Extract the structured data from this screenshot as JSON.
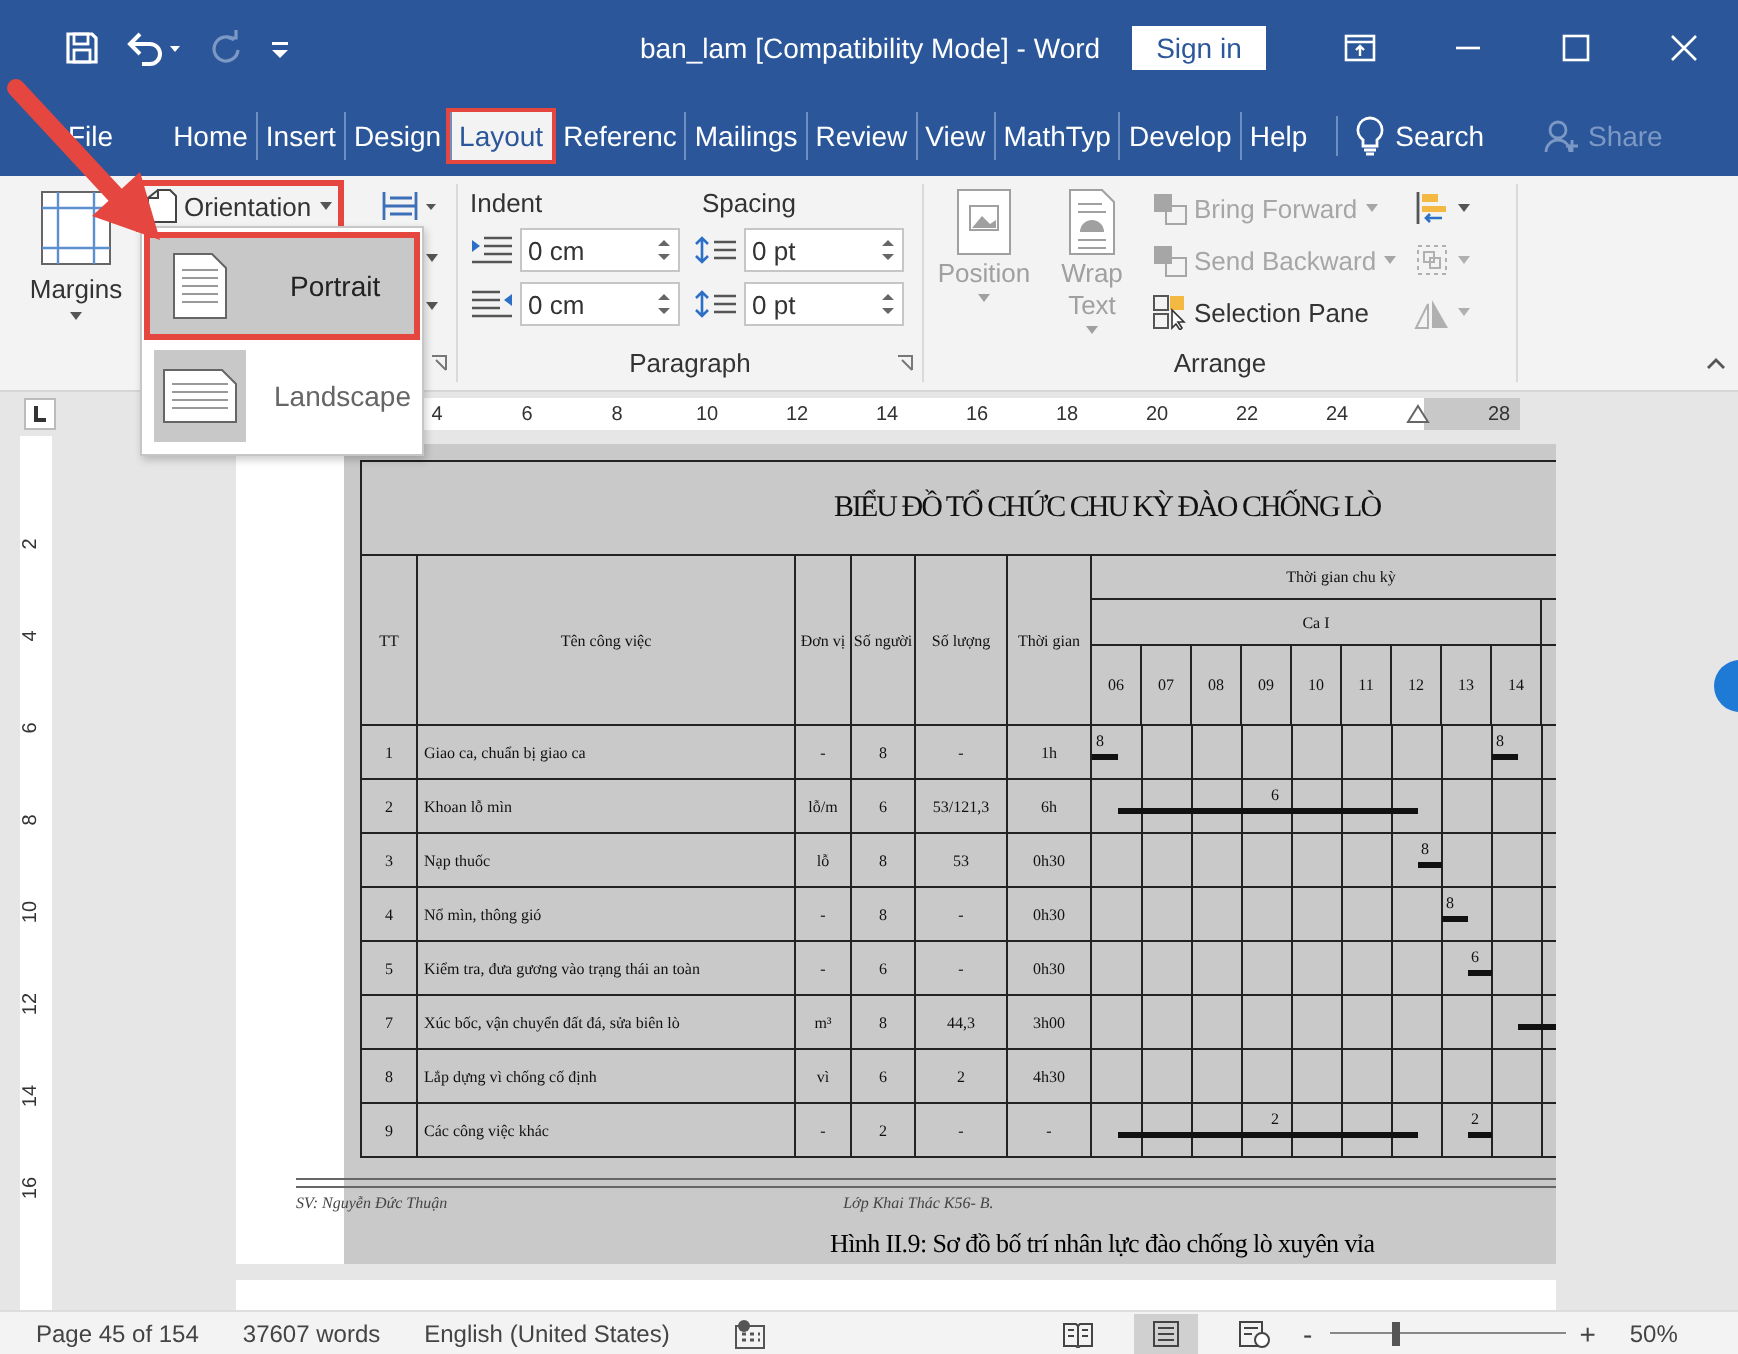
{
  "title_bar": {
    "title": "ban_lam [Compatibility Mode]  -  Word",
    "sign_in": "Sign in",
    "quick_access": [
      {
        "kind": "save",
        "disabled": false
      },
      {
        "kind": "undo",
        "disabled": false
      },
      {
        "kind": "redo",
        "disabled": true
      },
      {
        "kind": "customize",
        "disabled": false
      }
    ]
  },
  "tabs": [
    {
      "label": "File",
      "selected": false,
      "highlighted": false
    },
    {
      "label": "Home",
      "selected": false,
      "highlighted": false
    },
    {
      "label": "Insert",
      "selected": false,
      "highlighted": false
    },
    {
      "label": "Design",
      "selected": false,
      "highlighted": false
    },
    {
      "label": "Layout",
      "selected": true,
      "highlighted": true
    },
    {
      "label": "Referenc",
      "selected": false,
      "highlighted": false
    },
    {
      "label": "Mailings",
      "selected": false,
      "highlighted": false
    },
    {
      "label": "Review",
      "selected": false,
      "highlighted": false
    },
    {
      "label": "View",
      "selected": false,
      "highlighted": false
    },
    {
      "label": "MathTyp",
      "selected": false,
      "highlighted": false
    },
    {
      "label": "Develop",
      "selected": false,
      "highlighted": false
    },
    {
      "label": "Help",
      "selected": false,
      "highlighted": false
    }
  ],
  "search": {
    "label": "Search"
  },
  "share": {
    "label": "Share",
    "disabled": true
  },
  "ribbon": {
    "margins": {
      "label": "Margins"
    },
    "orientation": {
      "label": "Orientation",
      "highlighted": true
    },
    "orientation_menu": [
      {
        "label": "Portrait",
        "kind": "portrait",
        "selected": true,
        "highlighted": true
      },
      {
        "label": "Landscape",
        "kind": "landscape",
        "selected": false,
        "highlighted": false
      }
    ],
    "paragraph": {
      "title": "Paragraph",
      "indent_label": "Indent",
      "spacing_label": "Spacing",
      "indent_left": "0 cm",
      "indent_right": "0 cm",
      "spacing_before": "0 pt",
      "spacing_after": "0 pt"
    },
    "arrange": {
      "title": "Arrange",
      "large_buttons": [
        {
          "label": "Position",
          "kind": "position",
          "disabled": true
        },
        {
          "label": "Wrap Text",
          "kind": "wrap",
          "disabled": true
        }
      ],
      "small_buttons": [
        {
          "label": "Bring Forward",
          "kind": "bring-forward",
          "disabled": true
        },
        {
          "label": "Send Backward",
          "kind": "send-backward",
          "disabled": true
        },
        {
          "label": "Selection Pane",
          "kind": "selection-pane",
          "disabled": false
        }
      ],
      "icon_buttons": [
        {
          "kind": "align",
          "disabled": false
        },
        {
          "kind": "group",
          "disabled": true
        },
        {
          "kind": "rotate",
          "disabled": true
        }
      ]
    }
  },
  "ruler": {
    "horizontal": [
      "4",
      "6",
      "8",
      "10",
      "12",
      "14",
      "16",
      "18",
      "20",
      "22",
      "24"
    ],
    "horizontal_end": "28",
    "vertical": [
      "2",
      "4",
      "6",
      "8",
      "10",
      "12",
      "14",
      "16"
    ]
  },
  "document": {
    "title": "BIỂU ĐỒ TỔ CHỨC CHU KỲ ĐÀO CHỐNG LÒ",
    "columns": [
      "TT",
      "Tên công việc",
      "Đơn vị",
      "Số người",
      "Số lượng",
      "Thời gian"
    ],
    "schedule_header": "Thời gian chu kỳ",
    "shift": "Ca I",
    "hours": [
      "06",
      "07",
      "08",
      "09",
      "10",
      "11",
      "12",
      "13",
      "14"
    ],
    "rows": [
      {
        "cells": [
          "1",
          "Giao ca, chuẩn bị giao ca",
          "-",
          "8",
          "-",
          "1h"
        ],
        "slots": [
          {
            "filled": true,
            "label": "8"
          },
          {
            "filled": false
          },
          {
            "filled": false
          },
          {
            "filled": false
          },
          {
            "filled": false
          },
          {
            "filled": false
          },
          {
            "filled": false
          },
          {
            "filled": false
          },
          {
            "filled": false
          },
          {
            "filled": false
          },
          {
            "filled": false
          },
          {
            "filled": false
          },
          {
            "filled": false
          },
          {
            "filled": false
          },
          {
            "filled": false
          },
          {
            "filled": false
          },
          {
            "filled": true,
            "label": "8"
          },
          {
            "filled": false
          },
          {
            "filled": false
          }
        ]
      },
      {
        "cells": [
          "2",
          "Khoan lỗ mìn",
          "lỗ/m",
          "6",
          "53/121,3",
          "6h"
        ],
        "slots": [
          {
            "filled": false
          },
          {
            "filled": true
          },
          {
            "filled": true
          },
          {
            "filled": true
          },
          {
            "filled": true
          },
          {
            "filled": true
          },
          {
            "filled": true
          },
          {
            "filled": true,
            "label": "6"
          },
          {
            "filled": true
          },
          {
            "filled": true
          },
          {
            "filled": true
          },
          {
            "filled": true
          },
          {
            "filled": true
          },
          {
            "filled": false
          },
          {
            "filled": false
          },
          {
            "filled": false
          },
          {
            "filled": false
          },
          {
            "filled": false
          },
          {
            "filled": false
          }
        ]
      },
      {
        "cells": [
          "3",
          "Nạp thuốc",
          "lỗ",
          "8",
          "53",
          "0h30"
        ],
        "slots": [
          {
            "filled": false
          },
          {
            "filled": false
          },
          {
            "filled": false
          },
          {
            "filled": false
          },
          {
            "filled": false
          },
          {
            "filled": false
          },
          {
            "filled": false
          },
          {
            "filled": false
          },
          {
            "filled": false
          },
          {
            "filled": false
          },
          {
            "filled": false
          },
          {
            "filled": false
          },
          {
            "filled": false
          },
          {
            "filled": true,
            "label": "8"
          },
          {
            "filled": false
          },
          {
            "filled": false
          },
          {
            "filled": false
          },
          {
            "filled": false
          },
          {
            "filled": false
          }
        ]
      },
      {
        "cells": [
          "4",
          "Nổ mìn, thông gió",
          "-",
          "8",
          "-",
          "0h30"
        ],
        "slots": [
          {
            "filled": false
          },
          {
            "filled": false
          },
          {
            "filled": false
          },
          {
            "filled": false
          },
          {
            "filled": false
          },
          {
            "filled": false
          },
          {
            "filled": false
          },
          {
            "filled": false
          },
          {
            "filled": false
          },
          {
            "filled": false
          },
          {
            "filled": false
          },
          {
            "filled": false
          },
          {
            "filled": false
          },
          {
            "filled": false
          },
          {
            "filled": true,
            "label": "8"
          },
          {
            "filled": false
          },
          {
            "filled": false
          },
          {
            "filled": false
          },
          {
            "filled": false
          }
        ]
      },
      {
        "cells": [
          "5",
          "Kiểm tra, đưa gương vào trạng thái an toàn",
          "-",
          "6",
          "-",
          "0h30"
        ],
        "slots": [
          {
            "filled": false
          },
          {
            "filled": false
          },
          {
            "filled": false
          },
          {
            "filled": false
          },
          {
            "filled": false
          },
          {
            "filled": false
          },
          {
            "filled": false
          },
          {
            "filled": false
          },
          {
            "filled": false
          },
          {
            "filled": false
          },
          {
            "filled": false
          },
          {
            "filled": false
          },
          {
            "filled": false
          },
          {
            "filled": false
          },
          {
            "filled": false
          },
          {
            "filled": true,
            "label": "6"
          },
          {
            "filled": false
          },
          {
            "filled": false
          },
          {
            "filled": false
          }
        ]
      },
      {
        "cells": [
          "7",
          "Xúc bốc, vận chuyển đất đá, sửa biên lò",
          "m³",
          "8",
          "44,3",
          "3h00"
        ],
        "slots": [
          {
            "filled": false
          },
          {
            "filled": false
          },
          {
            "filled": false
          },
          {
            "filled": false
          },
          {
            "filled": false
          },
          {
            "filled": false
          },
          {
            "filled": false
          },
          {
            "filled": false
          },
          {
            "filled": false
          },
          {
            "filled": false
          },
          {
            "filled": false
          },
          {
            "filled": false
          },
          {
            "filled": false
          },
          {
            "filled": false
          },
          {
            "filled": false
          },
          {
            "filled": false
          },
          {
            "filled": false
          },
          {
            "filled": true
          },
          {
            "filled": true
          }
        ]
      },
      {
        "cells": [
          "8",
          "Lắp dựng vì chống cố định",
          "vì",
          "6",
          "2",
          "4h30"
        ],
        "slots": [
          {
            "filled": false
          },
          {
            "filled": false
          },
          {
            "filled": false
          },
          {
            "filled": false
          },
          {
            "filled": false
          },
          {
            "filled": false
          },
          {
            "filled": false
          },
          {
            "filled": false
          },
          {
            "filled": false
          },
          {
            "filled": false
          },
          {
            "filled": false
          },
          {
            "filled": false
          },
          {
            "filled": false
          },
          {
            "filled": false
          },
          {
            "filled": false
          },
          {
            "filled": false
          },
          {
            "filled": false
          },
          {
            "filled": false
          },
          {
            "filled": false
          }
        ]
      },
      {
        "cells": [
          "9",
          "Các công việc khác",
          "-",
          "2",
          "-",
          "-"
        ],
        "slots": [
          {
            "filled": false
          },
          {
            "filled": true
          },
          {
            "filled": true
          },
          {
            "filled": true
          },
          {
            "filled": true
          },
          {
            "filled": true
          },
          {
            "filled": true
          },
          {
            "filled": true,
            "label": "2"
          },
          {
            "filled": true
          },
          {
            "filled": true
          },
          {
            "filled": true
          },
          {
            "filled": true
          },
          {
            "filled": true
          },
          {
            "filled": false
          },
          {
            "filled": false
          },
          {
            "filled": true,
            "label": "2"
          },
          {
            "filled": false
          },
          {
            "filled": false
          },
          {
            "filled": false
          }
        ]
      }
    ],
    "author": "SV: Nguyễn Đức Thuận",
    "class_name": "Lớp Khai Thác K56- B.",
    "caption": "Hình II.9: Sơ đồ bố trí nhân lực đào chống lò xuyên vỉa"
  },
  "status_bar": {
    "page": "Page 45 of 154",
    "words": "37607 words",
    "language": "English (United States)",
    "views": [
      {
        "kind": "read",
        "selected": false
      },
      {
        "kind": "print",
        "selected": true
      },
      {
        "kind": "web",
        "selected": false
      }
    ],
    "zoom": {
      "minus": "-",
      "plus": "+",
      "level": 0.28,
      "value": "50%"
    }
  }
}
